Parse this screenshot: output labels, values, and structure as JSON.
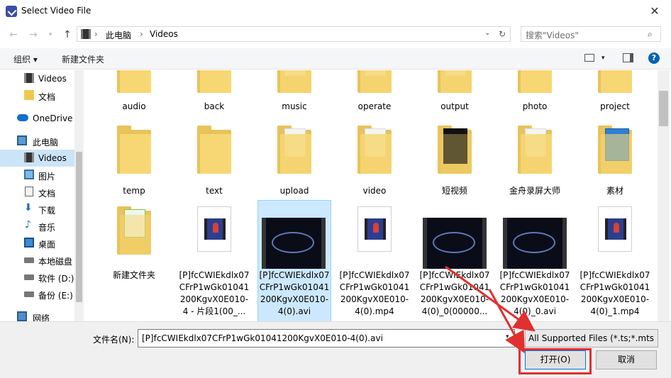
{
  "window": {
    "title": "Select Video File",
    "close_glyph": "✕"
  },
  "address": {
    "crumbs": [
      "此电脑",
      "Videos"
    ],
    "separator": "›"
  },
  "search": {
    "placeholder": "搜索\"Videos\""
  },
  "toolbar": {
    "organize": "组织 ▾",
    "new_folder": "新建文件夹"
  },
  "sidebar": {
    "items": [
      {
        "label": "Videos",
        "icon": "video-library-icon"
      },
      {
        "label": "文档",
        "icon": "folder-icon"
      },
      {
        "label": "OneDrive",
        "icon": "cloud-icon"
      },
      {
        "label": "此电脑",
        "icon": "computer-icon"
      },
      {
        "label": "Videos",
        "icon": "video-library-icon",
        "selected": true
      },
      {
        "label": "图片",
        "icon": "pictures-icon"
      },
      {
        "label": "文档",
        "icon": "documents-icon"
      },
      {
        "label": "下载",
        "icon": "download-icon"
      },
      {
        "label": "音乐",
        "icon": "music-icon"
      },
      {
        "label": "桌面",
        "icon": "desktop-icon"
      },
      {
        "label": "本地磁盘",
        "icon": "drive-icon"
      },
      {
        "label": "软件 (D:)",
        "icon": "drive-icon"
      },
      {
        "label": "备份 (E:)",
        "icon": "drive-icon"
      },
      {
        "label": "网络",
        "icon": "network-icon"
      }
    ]
  },
  "files": {
    "row1": [
      "audio",
      "back",
      "music",
      "operate",
      "output",
      "photo",
      "project"
    ],
    "row2": [
      "temp",
      "text",
      "upload",
      "video",
      "短视频",
      "金舟录屏大师",
      "素材"
    ],
    "row3": [
      "新建文件夹",
      "[P]fcCWIEkdlx07CFrP1wGk01041200KgvX0E010-4 - 片段1(00_...",
      "[P]fcCWIEkdlx07CFrP1wGk01041200KgvX0E010-4(0).avi",
      "[P]fcCWIEkdlx07CFrP1wGk01041200KgvX0E010-4(0).mp4",
      "[P]fcCWIEkdlx07CFrP1wGk01041200KgvX0E010-4(0)_0(00000...",
      "[P]fcCWIEkdlx07CFrP1wGk01041200KgvX0E010-4(0)_0.avi",
      "[P]fcCWIEkdlx07CFrP1wGk01041200KgvX0E010-4(0)_1.mp4"
    ]
  },
  "footer": {
    "filename_label": "文件名(N):",
    "filename_value": "[P]fcCWIEkdlx07CFrP1wGk01041200KgvX0E010-4(0).avi",
    "filter": "All Supported Files (*.ts;*.mts",
    "open": "打开(O)",
    "cancel": "取消"
  },
  "colors": {
    "selection": "#cce8ff",
    "highlight": "#e03030",
    "folder": "#f7d774"
  }
}
